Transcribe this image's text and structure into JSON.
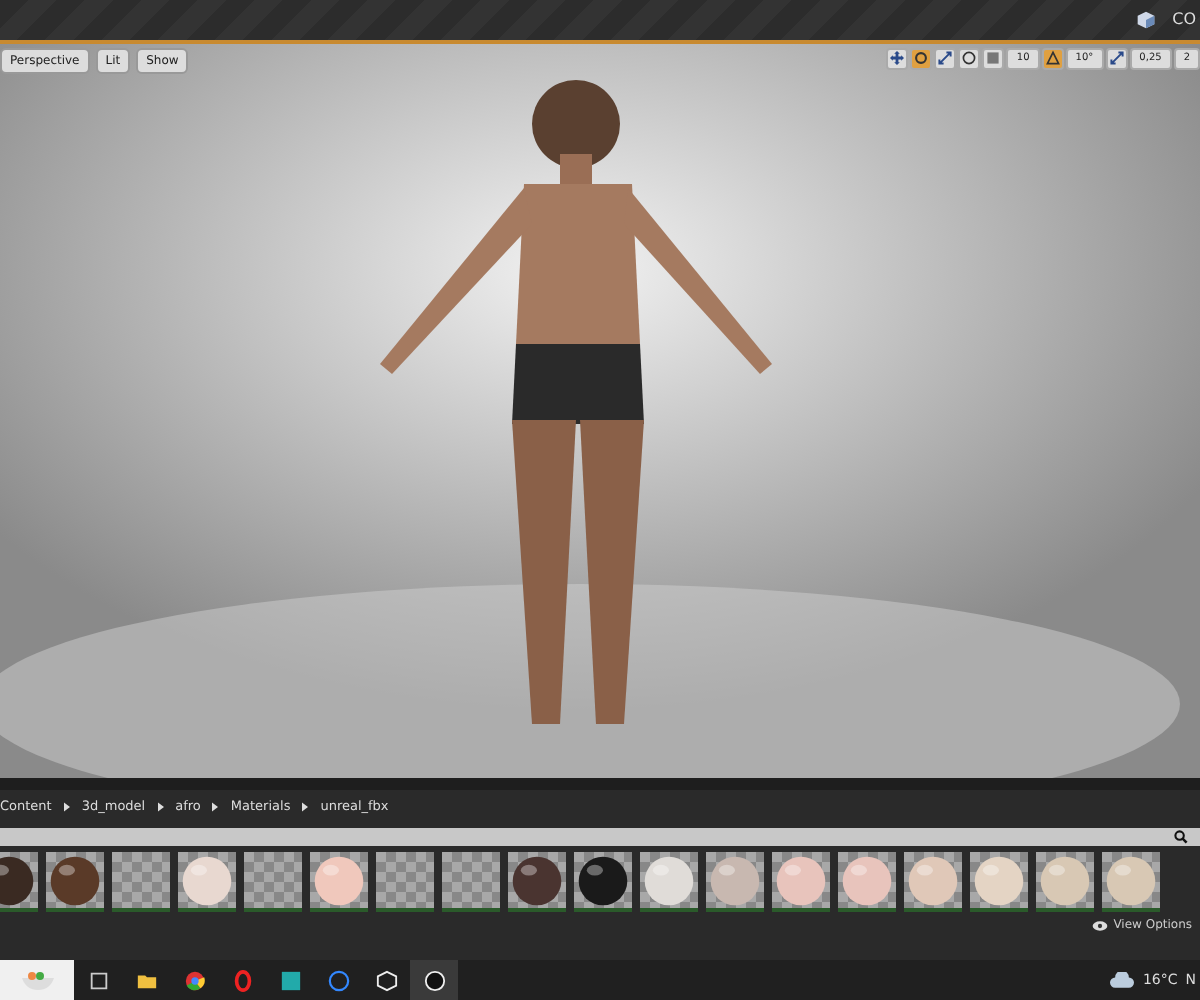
{
  "title_bar": {
    "tab_text": "CO"
  },
  "viewport": {
    "left_buttons": [
      "Perspective",
      "Lit",
      "Show"
    ],
    "tools": [
      {
        "kind": "icon",
        "selected": false
      },
      {
        "kind": "icon",
        "selected": true
      },
      {
        "kind": "icon",
        "selected": false
      },
      {
        "kind": "icon",
        "selected": false
      },
      {
        "kind": "icon",
        "selected": false
      },
      {
        "kind": "text",
        "text": "10",
        "selected": false
      },
      {
        "kind": "icon",
        "selected": true
      },
      {
        "kind": "text",
        "text": "10°",
        "selected": false
      },
      {
        "kind": "icon",
        "selected": false
      },
      {
        "kind": "text",
        "text": "0,25",
        "selected": false
      },
      {
        "kind": "text",
        "text": "2",
        "selected": false
      }
    ]
  },
  "content_browser": {
    "breadcrumbs": [
      "Content",
      "3d_model",
      "afro",
      "Materials",
      "unreal_fbx"
    ],
    "assets": [
      {
        "kind": "sphere",
        "color": "#3a2a22"
      },
      {
        "kind": "sphere",
        "color": "#5a3a28"
      },
      {
        "kind": "empty"
      },
      {
        "kind": "sphere",
        "color": "#e8d8d0"
      },
      {
        "kind": "empty"
      },
      {
        "kind": "sphere",
        "color": "#f0c8bc"
      },
      {
        "kind": "empty"
      },
      {
        "kind": "empty"
      },
      {
        "kind": "sphere",
        "color": "#4a3430"
      },
      {
        "kind": "sphere",
        "color": "#1a1a1a"
      },
      {
        "kind": "sphere",
        "color": "#e0dcd8"
      },
      {
        "kind": "sphere",
        "color": "#c8b8b0"
      },
      {
        "kind": "sphere",
        "color": "#e8c4bc"
      },
      {
        "kind": "sphere",
        "color": "#e8c4bc"
      },
      {
        "kind": "sphere",
        "color": "#e0c8b8"
      },
      {
        "kind": "sphere",
        "color": "#e4d4c4"
      },
      {
        "kind": "sphere",
        "color": "#d8c8b4"
      },
      {
        "kind": "sphere",
        "color": "#d8c8b4"
      }
    ],
    "view_options": "View Options"
  },
  "taskbar": {
    "apps": [
      {
        "selected": false
      },
      {
        "selected": false
      },
      {
        "selected": false
      },
      {
        "selected": false
      },
      {
        "selected": false
      },
      {
        "selected": false
      },
      {
        "selected": false
      },
      {
        "selected": true
      }
    ],
    "temperature": "16°C",
    "tray_text": "N"
  }
}
